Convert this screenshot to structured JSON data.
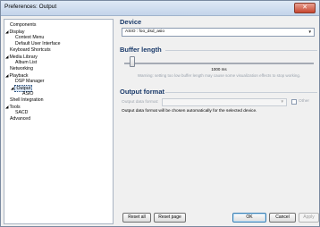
{
  "window": {
    "title": "Preferences: Output",
    "close_glyph": "✕"
  },
  "tree": [
    {
      "label": "Components"
    },
    {
      "label": "Display",
      "toggle": "◢"
    },
    {
      "label": "Context Menu"
    },
    {
      "label": "Default User Interface"
    },
    {
      "label": "Keyboard Shortcuts"
    },
    {
      "label": "Media Library",
      "toggle": "◢"
    },
    {
      "label": "Album List"
    },
    {
      "label": "Networking"
    },
    {
      "label": "Playback",
      "toggle": "◢"
    },
    {
      "label": "DSP Manager"
    },
    {
      "label": "Output",
      "toggle": "◢",
      "selected": true
    },
    {
      "label": "ASIO"
    },
    {
      "label": "Shell Integration"
    },
    {
      "label": "Tools",
      "toggle": "◢"
    },
    {
      "label": "SACD"
    },
    {
      "label": "Advanced"
    }
  ],
  "device": {
    "heading": "Device",
    "selected": "ASIO : foo_dsd_asio"
  },
  "buffer": {
    "heading": "Buffer length",
    "value_label": "1000 ms",
    "warning": "Warning: setting too low buffer length may cause some visualization effects to stop working."
  },
  "output_format": {
    "heading": "Output format",
    "label": "Output data format:",
    "other_label": "Other",
    "note": "Output data format will be chosen automatically for the selected device."
  },
  "buttons": {
    "reset_all": "Reset all",
    "reset_page": "Reset page",
    "ok": "OK",
    "cancel": "Cancel",
    "apply": "Apply"
  }
}
